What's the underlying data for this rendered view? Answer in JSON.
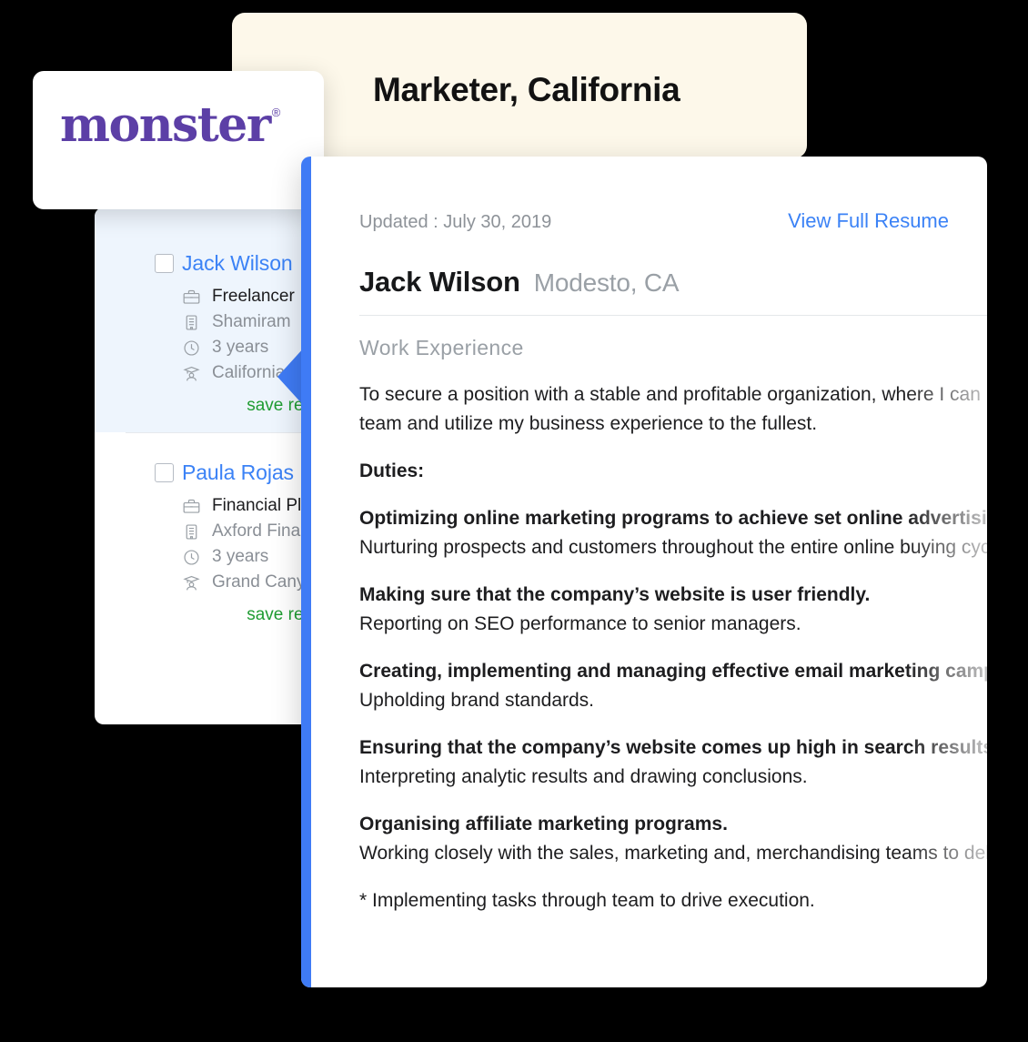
{
  "title_card": {
    "title": "Marketer, California",
    "bg_color": "#fdf8ea"
  },
  "logo_card": {
    "brand": "monster",
    "registered_mark": "®",
    "brand_color": "#5c3fa6"
  },
  "candidate_list": {
    "candidates": [
      {
        "name": "Jack Wilson",
        "selected": true,
        "job_title": "Freelancer",
        "company": "Shamiram",
        "experience": "3 years",
        "education": "California S",
        "save_label": "save resume",
        "checkbox_checked": false
      },
      {
        "name": "Paula Rojas",
        "selected": false,
        "job_title": "Financial Pl",
        "company": "Axford Fina",
        "experience": "3 years",
        "education": "Grand Cany",
        "save_label": "save resume",
        "checkbox_checked": false
      }
    ],
    "icons": {
      "job": "briefcase-icon",
      "company": "building-icon",
      "experience": "clock-icon",
      "education": "graduate-icon"
    },
    "selected_bg": "#eef5fd",
    "link_color": "#3b82f6",
    "save_color": "#1f9c32"
  },
  "resume_panel": {
    "accent_color": "#3f7bf5",
    "updated_label": "Updated : July 30, 2019",
    "view_full_resume": "View Full Resume",
    "candidate_name": "Jack Wilson",
    "candidate_location": "Modesto, CA",
    "section_heading": "Work Experience",
    "paragraphs": [
      {
        "lines": [
          {
            "text": "To secure a position with a stable and profitable organization, where I can be a part of a",
            "bold": false
          },
          {
            "text": "team and utilize my business experience to the fullest.",
            "bold": false
          }
        ]
      },
      {
        "lines": [
          {
            "text": "Duties:",
            "bold": true
          }
        ]
      },
      {
        "lines": [
          {
            "text": "Optimizing online marketing programs to achieve set online advertising goals.",
            "bold": true
          },
          {
            "text": "Nurturing prospects and customers throughout the entire online buying cycle.",
            "bold": false
          }
        ]
      },
      {
        "lines": [
          {
            "text": "Making sure that the company’s website is user friendly.",
            "bold": true
          },
          {
            "text": "Reporting on SEO performance to senior managers.",
            "bold": false
          }
        ]
      },
      {
        "lines": [
          {
            "text": "Creating, implementing and managing effective email marketing campaigns.",
            "bold": true
          },
          {
            "text": "Upholding brand standards.",
            "bold": false
          }
        ]
      },
      {
        "lines": [
          {
            "text": "Ensuring that the company’s website comes up high in search results.",
            "bold": true
          },
          {
            "text": "Interpreting analytic results and drawing conclusions.",
            "bold": false
          }
        ]
      },
      {
        "lines": [
          {
            "text": "Organising affiliate marketing programs.",
            "bold": true
          },
          {
            "text": "Working closely with the sales, marketing and, merchandising teams to deliver.",
            "bold": false
          }
        ]
      },
      {
        "lines": [
          {
            "text": "* Implementing tasks through team to drive execution.",
            "bold": false
          }
        ]
      }
    ]
  }
}
